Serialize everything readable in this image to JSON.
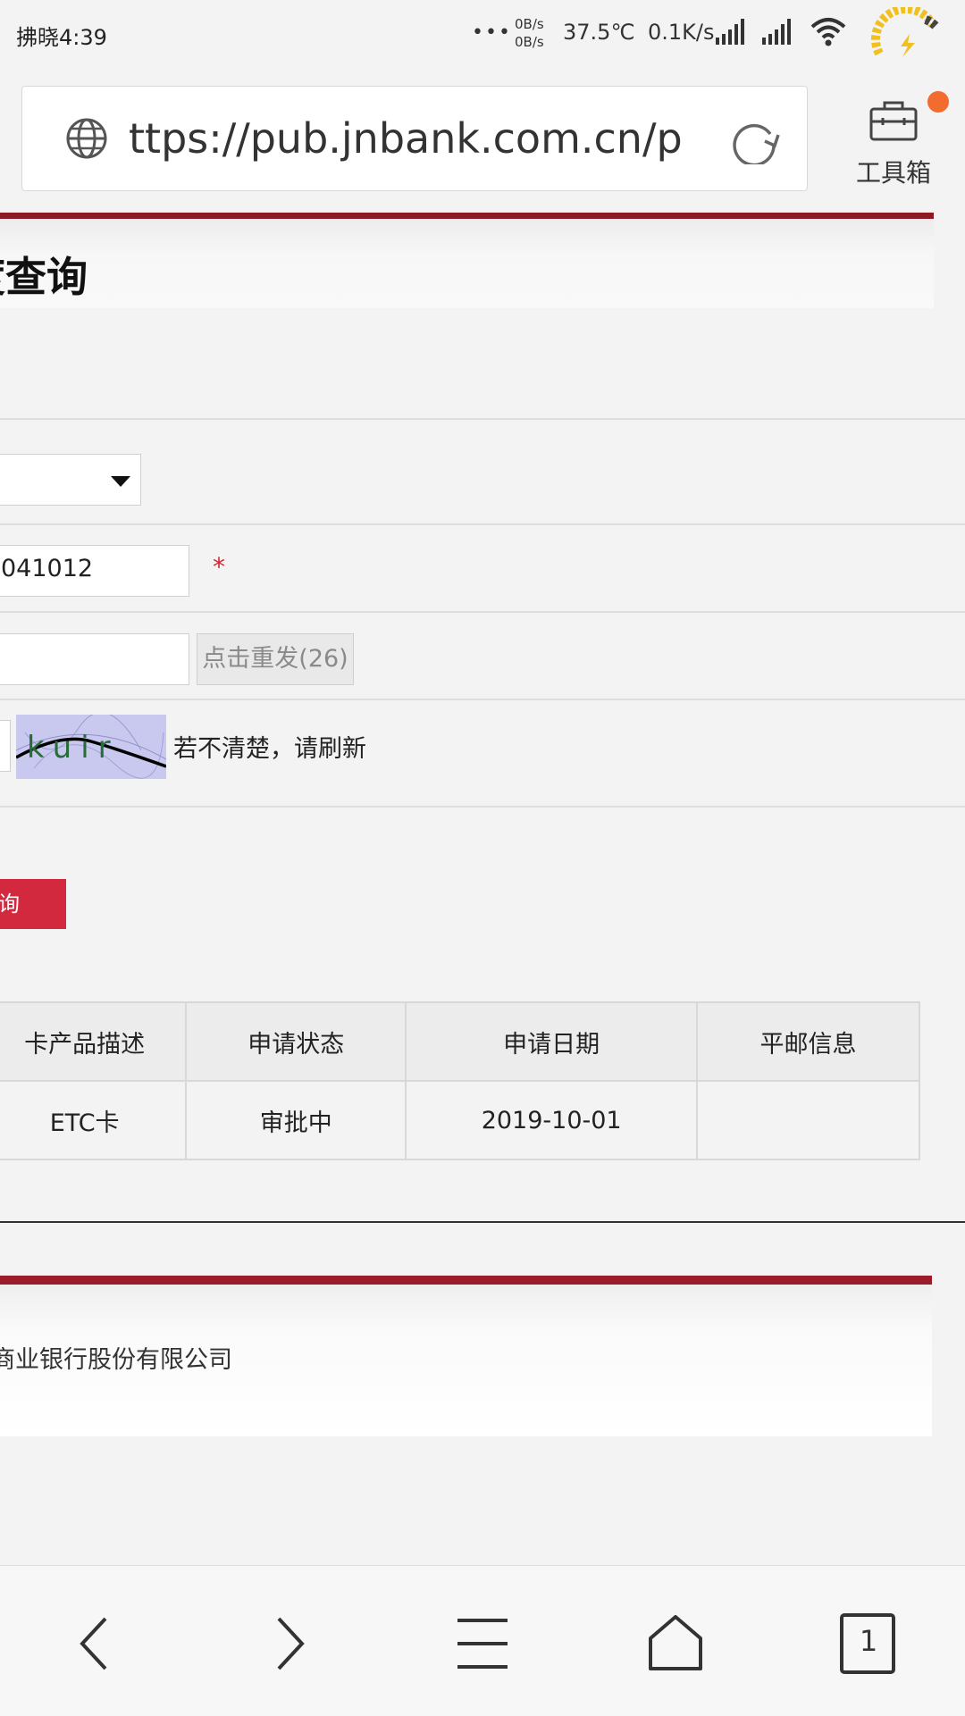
{
  "status_bar": {
    "time": "拂晓4:39",
    "dots": "•••",
    "net_up": "0B/s",
    "net_down": "0B/s",
    "temperature": "37.5℃",
    "speed": "0.1K/s"
  },
  "browser": {
    "url": "ttps://pub.jnbank.com.cn/p...",
    "toolbox_label": "工具箱",
    "tabs_count": "1"
  },
  "page": {
    "title": "度查询",
    "card_number_value": "041012",
    "required_mark": "*",
    "resend_label": "点击重发(26)",
    "captcha_text": "kuir",
    "captcha_hint": "若不清楚，请刷新",
    "query_button_label": "询"
  },
  "table": {
    "headers": [
      "卡产品描述",
      "申请状态",
      "申请日期",
      "平邮信息"
    ],
    "rows": [
      [
        "ETC卡",
        "审批中",
        "2019-10-01",
        ""
      ]
    ]
  },
  "footer": {
    "text": "商业银行股份有限公司"
  },
  "colors": {
    "brand_red": "#8b1a25",
    "button_red": "#d2293f",
    "notification_orange": "#f26b2f"
  }
}
